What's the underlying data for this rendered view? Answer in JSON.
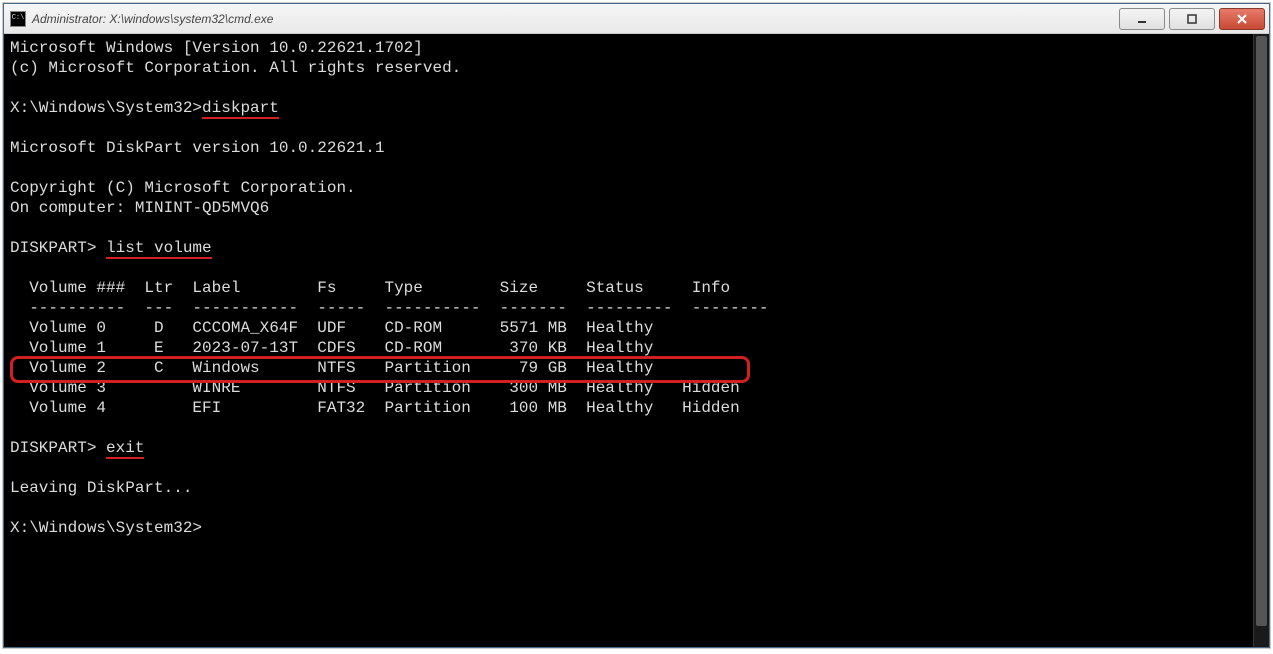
{
  "window": {
    "icon_text": "C:\\",
    "title": "Administrator: X:\\windows\\system32\\cmd.exe"
  },
  "terminal": {
    "banner1": "Microsoft Windows [Version 10.0.22621.1702]",
    "banner2": "(c) Microsoft Corporation. All rights reserved.",
    "prompt1_path": "X:\\Windows\\System32>",
    "cmd1": "diskpart",
    "dp_version": "Microsoft DiskPart version 10.0.22621.1",
    "dp_copyright": "Copyright (C) Microsoft Corporation.",
    "dp_computer": "On computer: MININT-QD5MVQ6",
    "dp_prompt": "DISKPART> ",
    "cmd2": "list volume",
    "table": {
      "header": "  Volume ###  Ltr  Label        Fs     Type        Size     Status     Info",
      "divider": "  ----------  ---  -----------  -----  ----------  -------  ---------  --------",
      "rows": [
        "  Volume 0     D   CCCOMA_X64F  UDF    CD-ROM      5571 MB  Healthy",
        "  Volume 1     E   2023-07-13T  CDFS   CD-ROM       370 KB  Healthy",
        "  Volume 2     C   Windows      NTFS   Partition     79 GB  Healthy",
        "  Volume 3         WINRE        NTFS   Partition    300 MB  Healthy   Hidden",
        "  Volume 4         EFI          FAT32  Partition    100 MB  Healthy   Hidden"
      ]
    },
    "cmd3": "exit",
    "leaving": "Leaving DiskPart...",
    "prompt2_path": "X:\\Windows\\System32>"
  },
  "highlight": {
    "row_index": 2,
    "note": "Volume 2 (C Windows NTFS) is boxed in red"
  }
}
